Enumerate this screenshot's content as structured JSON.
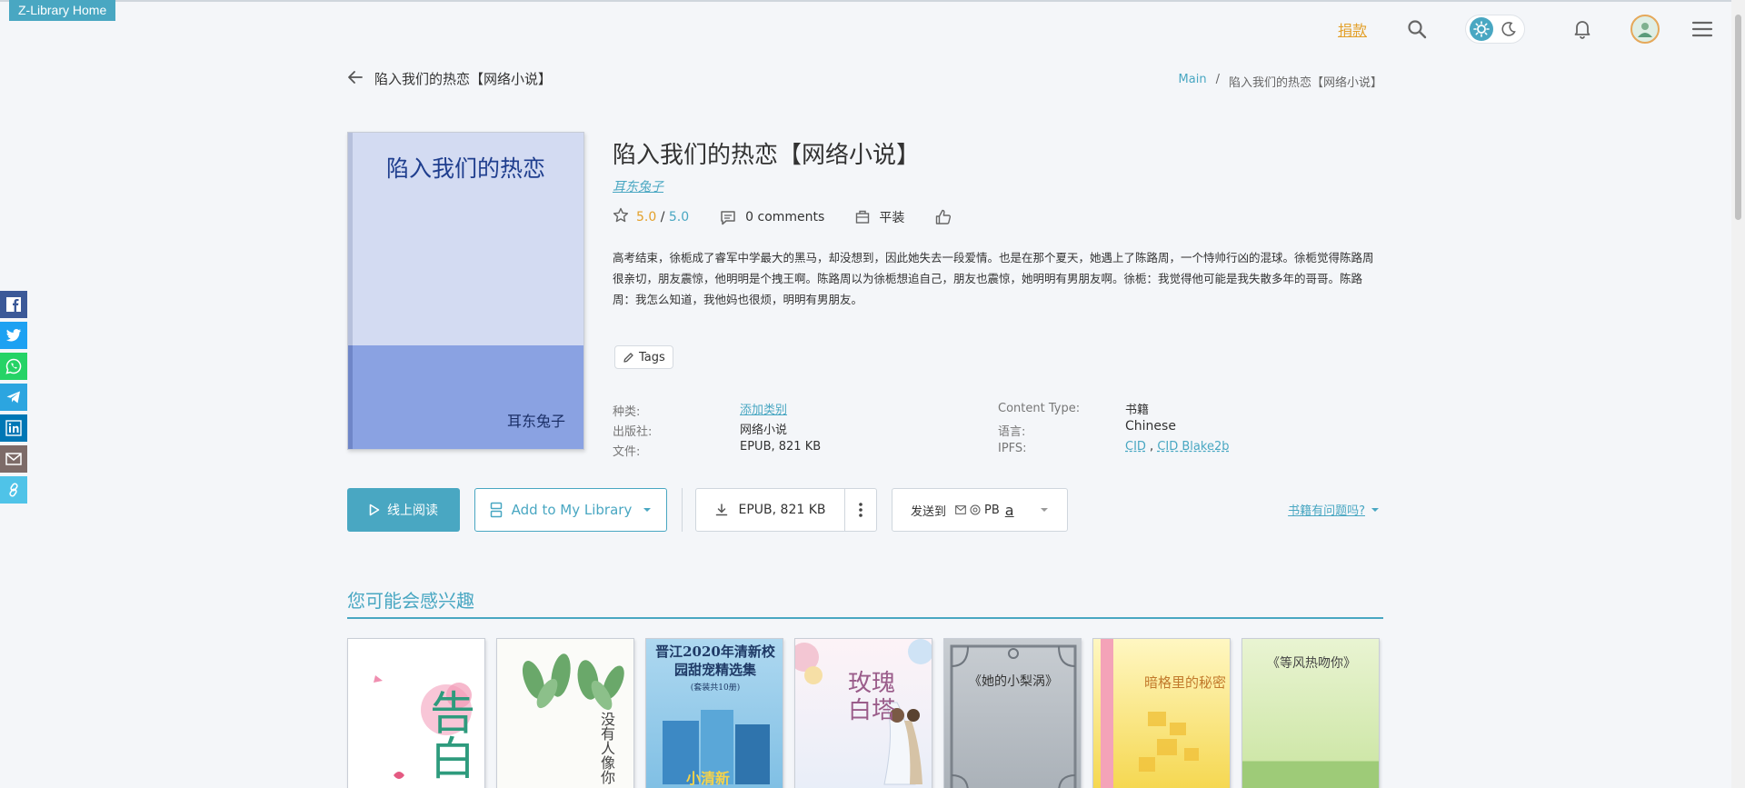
{
  "header": {
    "home_label": "Z-Library Home",
    "donate_label": "捐款",
    "icons": [
      "search-icon",
      "sun-icon",
      "moon-icon",
      "bell-icon",
      "avatar",
      "menu-icon"
    ]
  },
  "social": [
    "facebook-icon",
    "twitter-icon",
    "whatsapp-icon",
    "telegram-icon",
    "linkedin-icon",
    "email-icon",
    "link-icon"
  ],
  "page": {
    "back_title": "陷入我们的热恋【网络小说】",
    "breadcrumb": {
      "main": "Main",
      "sep": "/",
      "current": "陷入我们的热恋【网络小说】"
    }
  },
  "book": {
    "cover_title": "陷入我们的热恋",
    "cover_author": "耳东兔子",
    "title": "陷入我们的热恋【网络小说】",
    "author": "耳东兔子",
    "rating_value": "5.0",
    "rating_sep": " / ",
    "rating_max": "5.0",
    "comments": "0 comments",
    "binding": "平装",
    "description": "高考结束，徐栀成了睿军中学最大的黑马，却没想到，因此她失去一段爱情。也是在那个夏天，她遇上了陈路周，一个恃帅行凶的混球。徐栀觉得陈路周很亲切，朋友震惊，他明明是个拽王啊。陈路周以为徐栀想追自己，朋友也震惊，她明明有男朋友啊。徐栀：我觉得他可能是我失散多年的哥哥。陈路周：我怎么知道，我他妈也很烦，明明有男朋友。",
    "tags_label": "Tags",
    "props": {
      "category_label": "种类:",
      "category_value": "添加类别",
      "publisher_label": "出版社:",
      "publisher_value": "网络小说",
      "file_label": "文件:",
      "file_value": "EPUB, 821 KB",
      "content_type_label": "Content Type:",
      "content_type_value": "书籍",
      "language_label": "语言:",
      "language_value": "Chinese",
      "ipfs_label": "IPFS:",
      "ipfs_cid": "CID",
      "ipfs_sep": " , ",
      "ipfs_blake": "CID Blake2b"
    }
  },
  "actions": {
    "read_label": "线上阅读",
    "library_label": "Add to My Library",
    "download_label": "EPUB, 821 KB",
    "send_label": "发送到",
    "send_pb": "PB",
    "send_amazon": "a",
    "problem_label": "书籍有问题吗?"
  },
  "recommendations": {
    "title": "您可能会感兴趣",
    "items": [
      {
        "title": "告白"
      },
      {
        "title": "没有人像你"
      },
      {
        "title": "晋江2020年清新校园甜宠精选集",
        "subtitle": "(套装共10册)",
        "extra": "小清新"
      },
      {
        "title": "玫瑰白塔"
      },
      {
        "title": "《她的小梨涡》"
      },
      {
        "title": "暗格里的秘密"
      },
      {
        "title": "《等风热吻你》"
      }
    ]
  },
  "colors": {
    "accent": "#49a7c2",
    "donate": "#e3a02a",
    "cover_top": "#d3dbf2",
    "cover_bottom": "#8aa2e2"
  }
}
